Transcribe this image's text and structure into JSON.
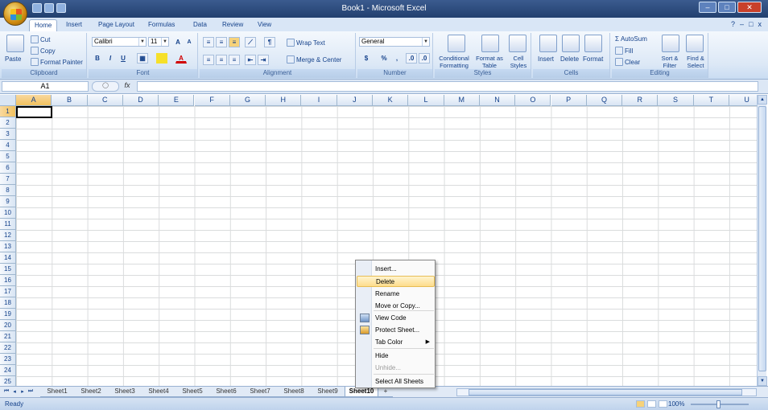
{
  "window": {
    "title": "Book1 - Microsoft Excel"
  },
  "ribbon_tabs": [
    "Home",
    "Insert",
    "Page Layout",
    "Formulas",
    "Data",
    "Review",
    "View"
  ],
  "clipboard": {
    "paste": "Paste",
    "cut": "Cut",
    "copy": "Copy",
    "format_painter": "Format Painter",
    "label": "Clipboard"
  },
  "font": {
    "name": "Calibri",
    "size": "11",
    "label": "Font",
    "bold": "B",
    "italic": "I",
    "underline": "U"
  },
  "alignment": {
    "wrap_text": "Wrap Text",
    "merge_center": "Merge & Center",
    "label": "Alignment"
  },
  "number": {
    "format": "General",
    "currency": "$",
    "percent": "%",
    "comma": ",",
    "label": "Number"
  },
  "styles": {
    "conditional": "Conditional Formatting",
    "format_table": "Format as Table",
    "cell_styles": "Cell Styles",
    "label": "Styles"
  },
  "cells_group": {
    "insert": "Insert",
    "delete": "Delete",
    "format": "Format",
    "label": "Cells"
  },
  "editing": {
    "autosum": "AutoSum",
    "fill": "Fill",
    "clear": "Clear",
    "sort_filter": "Sort & Filter",
    "find_select": "Find & Select",
    "label": "Editing"
  },
  "formula_bar": {
    "name_box": "A1",
    "fx": "fx",
    "value": ""
  },
  "columns": [
    "A",
    "B",
    "C",
    "D",
    "E",
    "F",
    "G",
    "H",
    "I",
    "J",
    "K",
    "L",
    "M",
    "N",
    "O",
    "P",
    "Q",
    "R",
    "S",
    "T",
    "U"
  ],
  "rows": [
    "1",
    "2",
    "3",
    "4",
    "5",
    "6",
    "7",
    "8",
    "9",
    "10",
    "11",
    "12",
    "13",
    "14",
    "15",
    "16",
    "17",
    "18",
    "19",
    "20",
    "21",
    "22",
    "23",
    "24",
    "25"
  ],
  "sheets": [
    "Sheet1",
    "Sheet2",
    "Sheet3",
    "Sheet4",
    "Sheet5",
    "Sheet6",
    "Sheet7",
    "Sheet8",
    "Sheet9",
    "Sheet10"
  ],
  "active_sheet": "Sheet10",
  "context_menu": {
    "items": [
      {
        "label": "Insert...",
        "state": "normal"
      },
      {
        "label": "Delete",
        "state": "hover"
      },
      {
        "label": "Rename",
        "state": "normal"
      },
      {
        "label": "Move or Copy...",
        "state": "normal"
      },
      {
        "label": "View Code",
        "state": "normal",
        "icon": "view-code-icon"
      },
      {
        "label": "Protect Sheet...",
        "state": "normal",
        "icon": "protect-sheet-icon"
      },
      {
        "label": "Tab Color",
        "state": "normal",
        "submenu": true
      },
      {
        "label": "Hide",
        "state": "normal"
      },
      {
        "label": "Unhide...",
        "state": "disabled"
      },
      {
        "label": "Select All Sheets",
        "state": "normal"
      }
    ]
  },
  "status": {
    "text": "Ready",
    "zoom": "100%"
  },
  "colors": {
    "title_bar": "#22406f",
    "selection": "#f1c15f",
    "menu_hover": "#fddc8c"
  }
}
